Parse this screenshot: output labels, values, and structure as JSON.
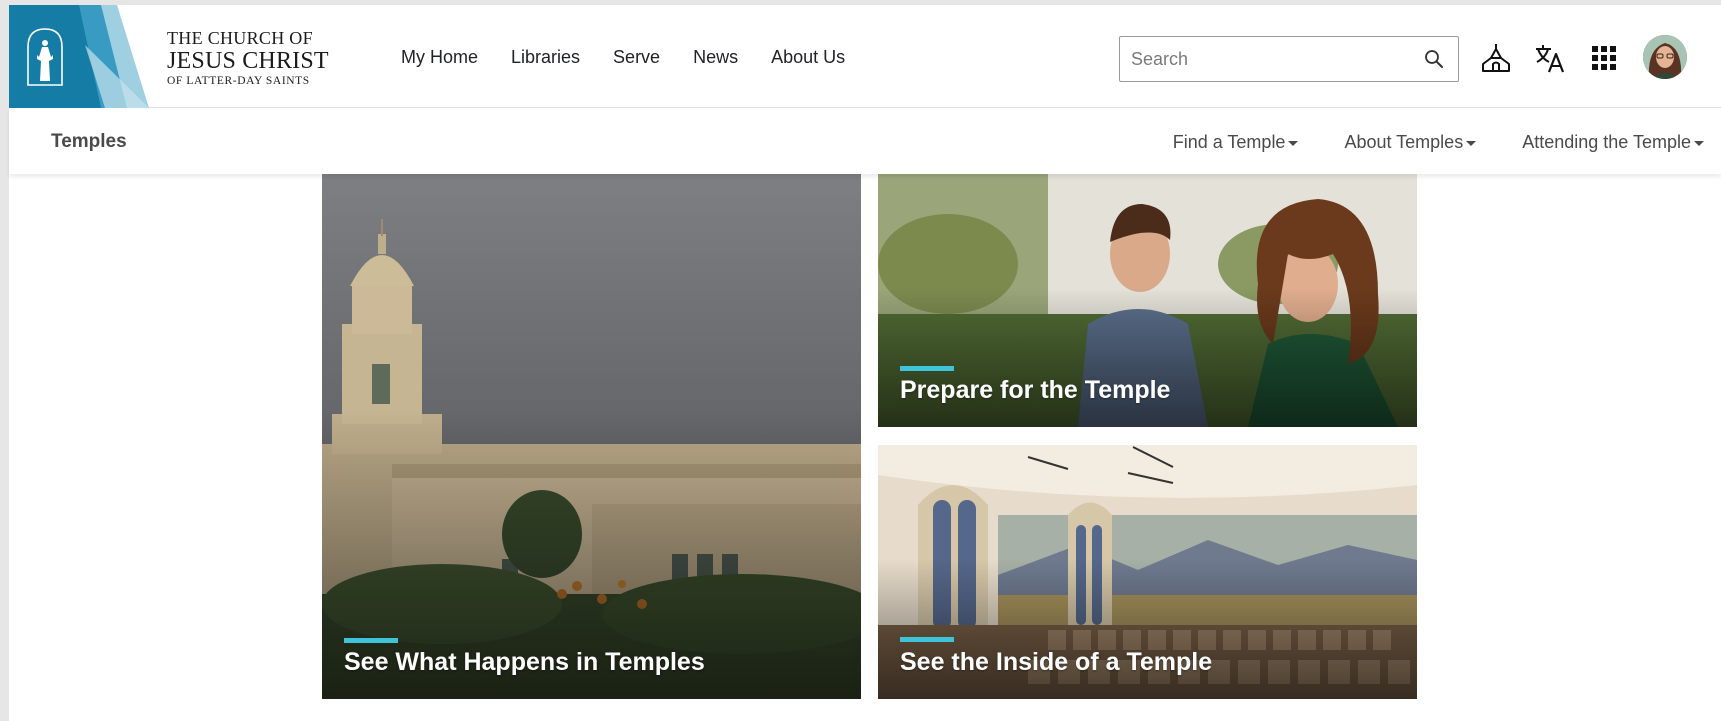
{
  "logo": {
    "line1": "THE CHURCH OF",
    "line2": "JESUS CHRIST",
    "line3": "OF LATTER-DAY SAINTS",
    "icon": "christus-statue-icon",
    "colors": {
      "primary": "#157ca5",
      "light": "#8fc4d8"
    }
  },
  "main_nav": {
    "items": [
      {
        "label": "My Home"
      },
      {
        "label": "Libraries"
      },
      {
        "label": "Serve"
      },
      {
        "label": "News"
      },
      {
        "label": "About Us"
      }
    ]
  },
  "search": {
    "placeholder": "Search",
    "value": "",
    "icon": "search-icon"
  },
  "header_icons": {
    "temple": "temple-icon",
    "language": "language-translate-icon",
    "apps": "apps-grid-icon",
    "avatar": "user-avatar"
  },
  "subnav": {
    "title": "Temples",
    "links": [
      {
        "label": "Find a Temple"
      },
      {
        "label": "About Temples"
      },
      {
        "label": "Attending the Temple"
      }
    ]
  },
  "tiles": [
    {
      "title": "See What Happens in Temples"
    },
    {
      "title": "Prepare for the Temple"
    },
    {
      "title": "See the Inside of a Temple"
    }
  ],
  "accent_color": "#3fc3d8"
}
